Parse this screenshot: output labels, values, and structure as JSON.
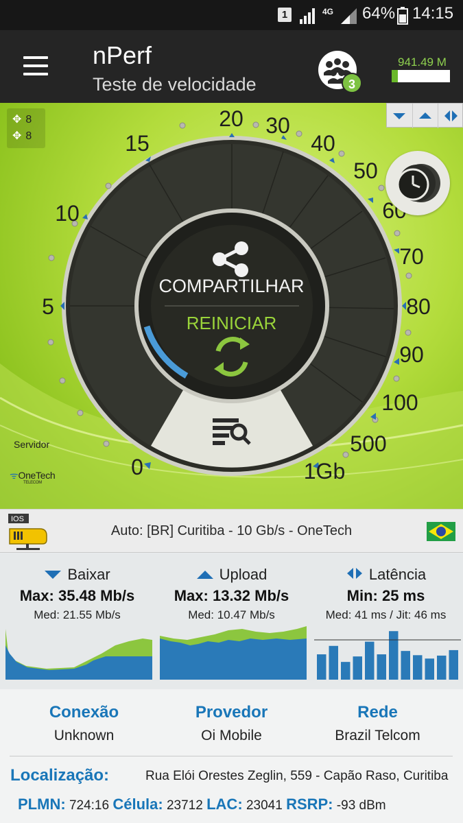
{
  "status_bar": {
    "sim_slot": "1",
    "network_type": "4G",
    "battery": "64%",
    "time": "14:15"
  },
  "app_bar": {
    "title": "nPerf",
    "subtitle": "Teste de velocidade",
    "users_badge": "3",
    "data_counter": "941.49 M"
  },
  "gauge": {
    "tick_labels": [
      "0",
      "5",
      "10",
      "15",
      "20",
      "30",
      "40",
      "50",
      "60",
      "70",
      "80",
      "90",
      "100",
      "500",
      "1Gb"
    ],
    "share_label": "COMPARTILHAR",
    "restart_label": "REINICIAR",
    "server_label": "Servidor",
    "server_logo": "OneTech",
    "server_logo_sub": "TELECOM",
    "sim_count_1": "8",
    "sim_count_2": "8"
  },
  "server": {
    "tag": "IOS",
    "text": "Auto: [BR] Curitiba - 10 Gb/s - OneTech"
  },
  "results": {
    "download": {
      "label": "Baixar",
      "max": "Max: 35.48 Mb/s",
      "med": "Med: 21.55 Mb/s"
    },
    "upload": {
      "label": "Upload",
      "max": "Max: 13.32 Mb/s",
      "med": "Med: 10.47 Mb/s"
    },
    "latency": {
      "label": "Latência",
      "min": "Min: 25 ms",
      "med": "Med: 41 ms / Jit: 46 ms",
      "bars": [
        0.6,
        0.8,
        0.42,
        0.55,
        0.9,
        0.6,
        1.15,
        0.68,
        0.58,
        0.5,
        0.57,
        0.7
      ]
    }
  },
  "info": {
    "conexao": {
      "label": "Conexão",
      "value": "Unknown"
    },
    "provedor": {
      "label": "Provedor",
      "value": "Oi Mobile"
    },
    "rede": {
      "label": "Rede",
      "value": "Brazil Telcom"
    },
    "localizacao": {
      "label": "Localização:",
      "value": "Rua Elói Orestes Zeglin, 559 - Capão Raso, Curitiba"
    },
    "plmn": {
      "label": "PLMN:",
      "value": "724:16"
    },
    "celula": {
      "label": "Célula:",
      "value": "23712"
    },
    "lac": {
      "label": "LAC:",
      "value": "23041"
    },
    "rsrp": {
      "label": "RSRP:",
      "value": "-93 dBm"
    }
  },
  "colors": {
    "accent_blue": "#1976b8",
    "accent_green": "#7dc242",
    "chart_blue": "#2a7ab8",
    "chart_green": "#8cc63f"
  }
}
